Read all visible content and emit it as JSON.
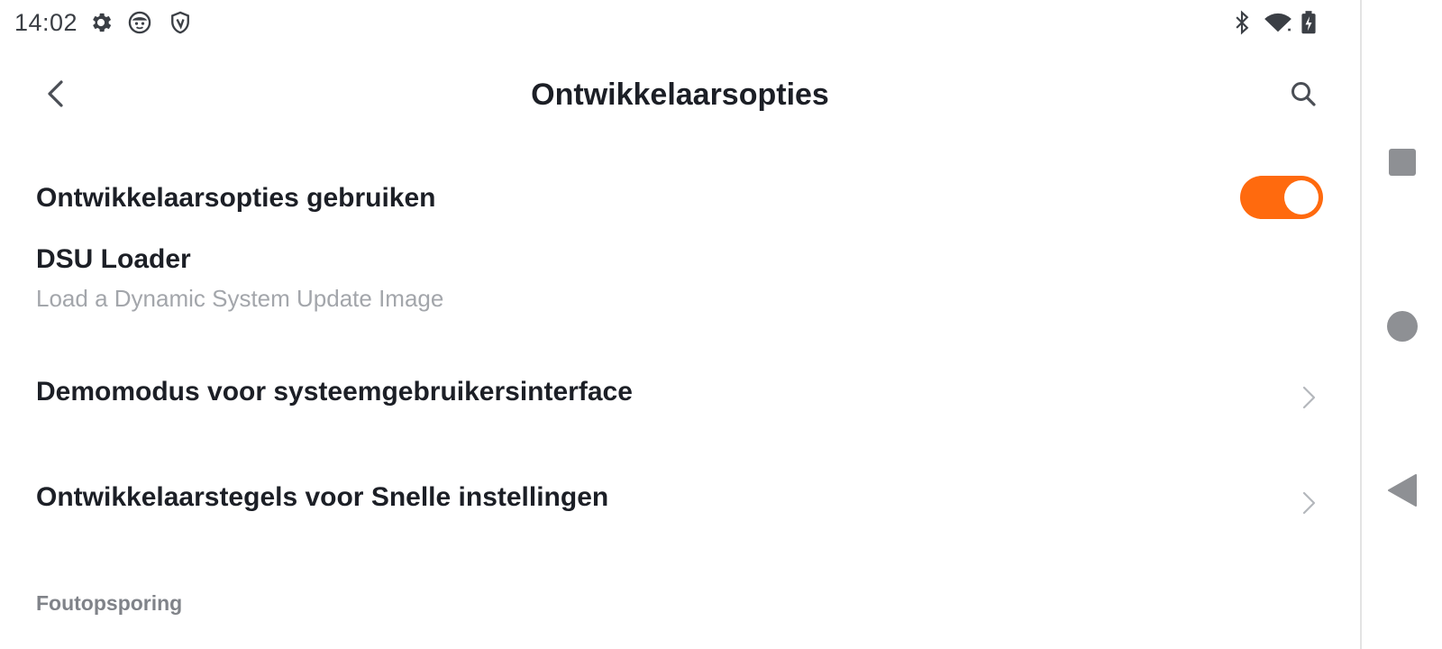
{
  "status_bar": {
    "time": "14:02",
    "left_icons": [
      "gear-icon",
      "face-icon",
      "shield-icon"
    ],
    "right_icons": [
      "bluetooth-icon",
      "wifi-icon",
      "battery-charging-icon"
    ]
  },
  "header": {
    "title": "Ontwikkelaarsopties",
    "back_icon": "chevron-left-icon",
    "search_icon": "search-icon"
  },
  "settings": {
    "use_dev_options": {
      "label": "Ontwikkelaarsopties gebruiken",
      "enabled": true
    },
    "dsu_loader": {
      "label": "DSU Loader",
      "subtitle": "Load a Dynamic System Update Image"
    },
    "demo_mode": {
      "label": "Demomodus voor systeemgebruikersinterface"
    },
    "quick_tiles": {
      "label": "Ontwikkelaarstegels voor Snelle instellingen"
    }
  },
  "sections": {
    "debugging": "Foutopsporing"
  },
  "nav_bar": {
    "buttons": [
      "recents-square-icon",
      "home-circle-icon",
      "back-triangle-icon"
    ]
  },
  "colors": {
    "accent": "#ff6a0e",
    "text_primary": "#1c1f26",
    "text_secondary": "#a3a6ab",
    "section_header": "#808389"
  }
}
